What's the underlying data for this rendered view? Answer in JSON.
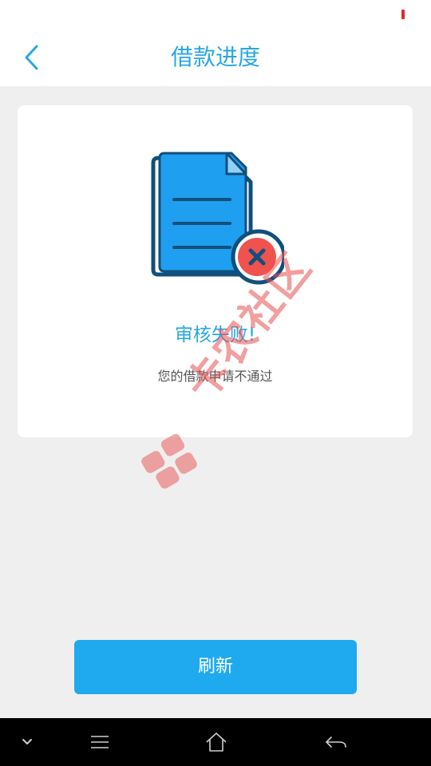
{
  "header": {
    "title": "借款进度",
    "back_icon": "chevron-left-icon"
  },
  "card": {
    "illustration_icon": "document-rejected-icon",
    "status_title": "审核失败!",
    "status_message": "您的借款申请不通过"
  },
  "refresh_button": {
    "label": "刷新"
  },
  "watermark": {
    "text": "卡农社区"
  },
  "nav_bar": {
    "items": [
      "chevron-down-icon",
      "menu-icon",
      "home-icon",
      "back-arrow-icon"
    ]
  },
  "colors": {
    "accent": "#27a7e0",
    "button": "#1faaf0",
    "error": "#f0524d",
    "doc_blue": "#1e9ff0",
    "doc_dark": "#114f7c",
    "background": "#efefef",
    "status_indicator": "#e0282a"
  }
}
